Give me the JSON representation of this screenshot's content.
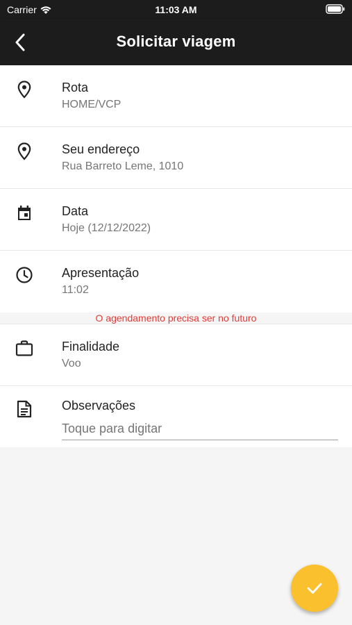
{
  "status_bar": {
    "carrier": "Carrier",
    "time": "11:03 AM"
  },
  "app_bar": {
    "title": "Solicitar viagem"
  },
  "rows": [
    {
      "label": "Rota",
      "value": "HOME/VCP",
      "icon": "location-pin-icon"
    },
    {
      "label": "Seu endereço",
      "value": "Rua Barreto Leme, 1010",
      "icon": "location-pin-icon"
    },
    {
      "label": "Data",
      "value": "Hoje (12/12/2022)",
      "icon": "calendar-icon"
    },
    {
      "label": "Apresentação",
      "value": "11:02",
      "icon": "clock-icon"
    }
  ],
  "warning": "O agendamento precisa ser no futuro",
  "purpose": {
    "label": "Finalidade",
    "value": "Voo",
    "icon": "briefcase-icon"
  },
  "observations": {
    "label": "Observações",
    "placeholder": "Toque para digitar",
    "value": "",
    "icon": "note-icon"
  },
  "colors": {
    "app_bar": "#1c1c1c",
    "fab": "#fbc02d",
    "warning": "#e53935"
  },
  "fab_icon": "check-icon"
}
